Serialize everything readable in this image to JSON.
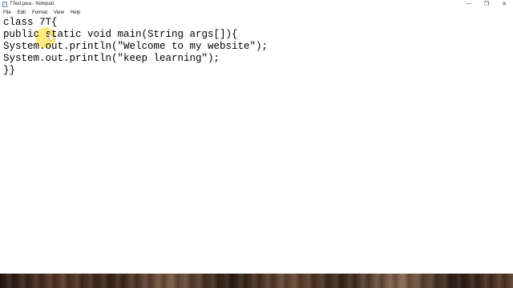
{
  "window": {
    "title": "7Test.java - Notepad",
    "icon": "notepad-icon"
  },
  "controls": {
    "minimize": "─",
    "maximize": "❐",
    "close": "✕"
  },
  "menu": {
    "items": [
      {
        "label": "File"
      },
      {
        "label": "Edit"
      },
      {
        "label": "Format"
      },
      {
        "label": "View"
      },
      {
        "label": "Help"
      }
    ]
  },
  "editor": {
    "lines": [
      "class 7T{",
      "public static void main(String args[]){",
      "System.out.println(\"Welcome to my website\");",
      "System.out.println(\"keep learning\");",
      "}}"
    ]
  }
}
